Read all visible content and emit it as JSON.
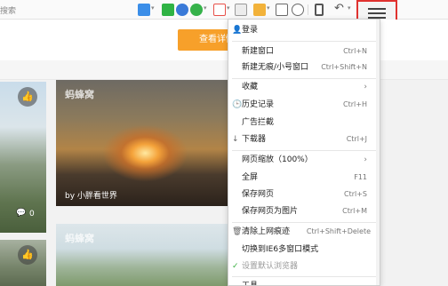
{
  "toolbar": {
    "search_hint": "搜索",
    "icons": [
      {
        "name": "apps-icon",
        "color": "#3b8ee8"
      },
      {
        "name": "shield-icon",
        "color": "#2fb344"
      },
      {
        "name": "globe-icon",
        "color": "#3a7ad8"
      },
      {
        "name": "coin-icon",
        "color": "#36b24a"
      },
      {
        "name": "translate-icon",
        "color": "#e8514a"
      },
      {
        "name": "scissors-icon",
        "color": "#777777"
      },
      {
        "name": "image-icon",
        "color": "#f2b23a"
      },
      {
        "name": "calculator-icon",
        "color": "#6a6a6a"
      },
      {
        "name": "zoom-icon",
        "color": "#6a6a6a"
      },
      {
        "name": "phone-icon",
        "color": "#555555"
      },
      {
        "name": "undo-icon",
        "color": "#555555"
      }
    ],
    "menu_button": "menu-icon"
  },
  "page": {
    "orange_button": "查看详情",
    "cards": [
      {
        "watermark": "",
        "caption": "",
        "comment_count": "0"
      },
      {
        "watermark": "蚂蜂窝",
        "caption": "by 小胖看世界",
        "comment_count": ""
      },
      {
        "watermark": "蚂蜂窝",
        "caption": "",
        "comment_count": ""
      }
    ]
  },
  "menu": {
    "items": [
      {
        "icon": "user-icon",
        "label": "登录",
        "shortcut": "",
        "arrow": false,
        "disabled": false
      },
      {
        "icon": "",
        "label": "新建窗口",
        "shortcut": "Ctrl+N",
        "arrow": false,
        "disabled": false
      },
      {
        "icon": "",
        "label": "新建无痕/小号窗口",
        "shortcut": "Ctrl+Shift+N",
        "arrow": false,
        "disabled": false
      },
      {
        "icon": "",
        "label": "收藏",
        "shortcut": "",
        "arrow": true,
        "disabled": false
      },
      {
        "icon": "clock-icon",
        "label": "历史记录",
        "shortcut": "Ctrl+H",
        "arrow": false,
        "disabled": false
      },
      {
        "icon": "",
        "label": "广告拦截",
        "shortcut": "",
        "arrow": false,
        "disabled": false
      },
      {
        "icon": "download-icon",
        "label": "下载器",
        "shortcut": "Ctrl+J",
        "arrow": false,
        "disabled": false
      },
      {
        "icon": "",
        "label": "网页缩放（100%）",
        "shortcut": "",
        "arrow": true,
        "disabled": false
      },
      {
        "icon": "",
        "label": "全屏",
        "shortcut": "F11",
        "arrow": false,
        "disabled": false
      },
      {
        "icon": "",
        "label": "保存网页",
        "shortcut": "Ctrl+S",
        "arrow": false,
        "disabled": false
      },
      {
        "icon": "",
        "label": "保存网页为图片",
        "shortcut": "Ctrl+M",
        "arrow": false,
        "disabled": false
      },
      {
        "icon": "trash-icon",
        "label": "清除上网痕迹",
        "shortcut": "Ctrl+Shift+Delete",
        "arrow": false,
        "disabled": false
      },
      {
        "icon": "",
        "label": "切换到IE6多窗口模式",
        "shortcut": "",
        "arrow": false,
        "disabled": false
      },
      {
        "icon": "check-icon",
        "label": "设置默认浏览器",
        "shortcut": "",
        "arrow": false,
        "disabled": true
      },
      {
        "icon": "",
        "label": "工具",
        "shortcut": "",
        "arrow": false,
        "disabled": false
      }
    ]
  }
}
